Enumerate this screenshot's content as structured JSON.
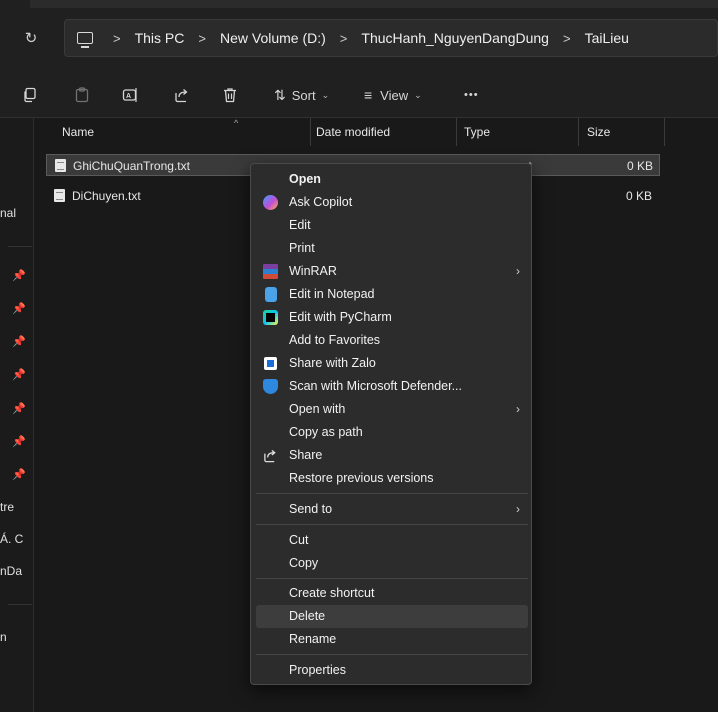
{
  "breadcrumb": {
    "items": [
      "This PC",
      "New Volume (D:)",
      "ThucHanh_NguyenDangDung",
      "TaiLieu"
    ],
    "separator": ">"
  },
  "toolbar": {
    "sort_label": "Sort",
    "view_label": "View",
    "more_label": "•••"
  },
  "sidebar": {
    "text_al": "nal",
    "text_tre": "tre",
    "text_ac": "Á. C",
    "text_nda": "nDa",
    "text_n": "n"
  },
  "columns": {
    "name": "Name",
    "date": "Date modified",
    "type": "Type",
    "size": "Size"
  },
  "files": [
    {
      "name": "GhiChuQuanTrong.txt",
      "type_fragment": "ent",
      "size": "0 KB",
      "selected": true
    },
    {
      "name": "DiChuyen.txt",
      "type_fragment": "ent",
      "size": "0 KB",
      "selected": false
    }
  ],
  "context_menu": {
    "open": "Open",
    "ask_copilot": "Ask Copilot",
    "edit": "Edit",
    "print": "Print",
    "winrar": "WinRAR",
    "edit_notepad": "Edit in Notepad",
    "edit_pycharm": "Edit with PyCharm",
    "add_favorites": "Add to Favorites",
    "share_zalo": "Share with Zalo",
    "scan_defender": "Scan with Microsoft Defender...",
    "open_with": "Open with",
    "copy_path": "Copy as path",
    "share": "Share",
    "restore": "Restore previous versions",
    "send_to": "Send to",
    "cut": "Cut",
    "copy": "Copy",
    "create_shortcut": "Create shortcut",
    "delete": "Delete",
    "rename": "Rename",
    "properties": "Properties",
    "submenu_arrow": "›"
  },
  "icons": {
    "refresh": "refresh-icon",
    "pc": "pc-icon",
    "copy": "copy-icon",
    "paste": "paste-icon",
    "rename": "rename-icon",
    "share": "share-icon",
    "delete": "trash-icon",
    "sort": "sort-icon",
    "view": "view-icon",
    "pin": "pin-icon"
  },
  "colors": {
    "background": "#1b1b1b",
    "menu_bg": "#2c2c2c",
    "hover": "#3d3d3d",
    "selection": "#3a3a3a"
  }
}
